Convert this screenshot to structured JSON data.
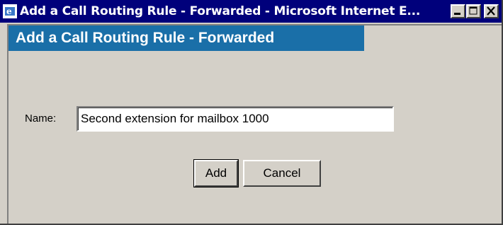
{
  "window": {
    "title": "Add a Call Routing Rule - Forwarded - Microsoft Internet E...",
    "icon": "ie-icon",
    "controls": {
      "minimize": "minimize-icon",
      "maximize": "maximize-icon",
      "close": "close-icon"
    }
  },
  "form": {
    "heading": "Add a Call Routing Rule - Forwarded",
    "name_label": "Name:",
    "name_value": "Second extension for mailbox 1000"
  },
  "actions": {
    "add_label": "Add",
    "cancel_label": "Cancel"
  },
  "colors": {
    "titlebar": "#00007b",
    "heading_bar": "#1a6fa8",
    "face": "#d4d0c8"
  }
}
